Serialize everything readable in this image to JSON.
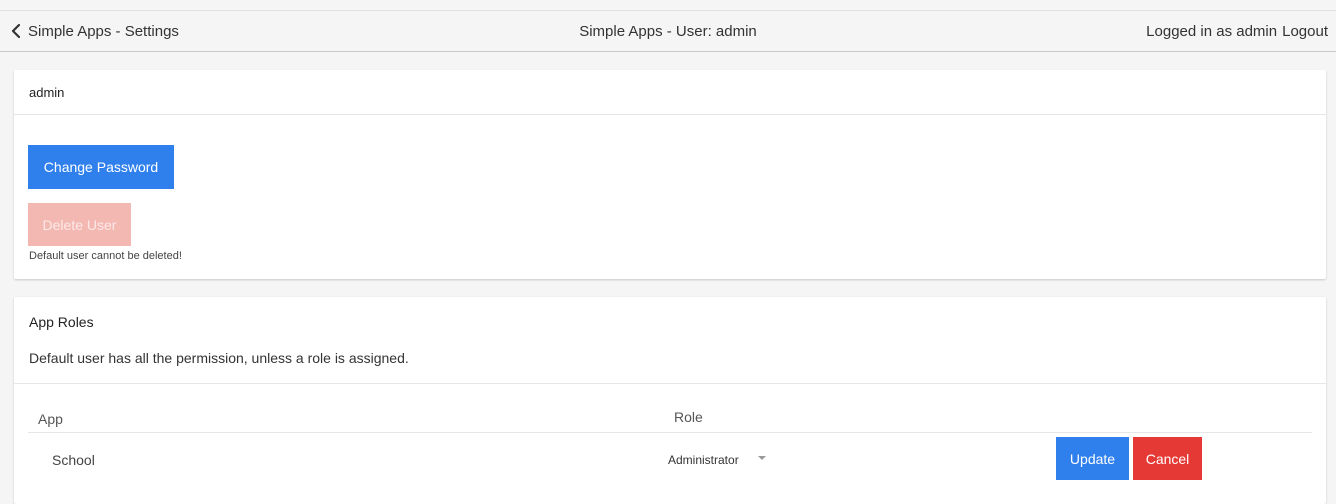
{
  "topbar": {
    "back_label": "Simple Apps - Settings",
    "title": "Simple Apps - User: admin",
    "logged_in_text": "Logged in as admin",
    "logout_label": "Logout"
  },
  "user_card": {
    "username": "admin",
    "change_password_label": "Change Password",
    "delete_user_label": "Delete User",
    "delete_note": "Default user cannot be deleted!"
  },
  "roles_card": {
    "title": "App Roles",
    "description": "Default user has all the permission, unless a role is assigned.",
    "columns": {
      "app": "App",
      "role": "Role"
    },
    "rows": [
      {
        "app": "School",
        "role": "Administrator"
      }
    ],
    "update_label": "Update",
    "cancel_label": "Cancel"
  },
  "colors": {
    "primary": "#2f80ed",
    "danger": "#e53935",
    "danger_disabled": "#f4b8b3"
  },
  "icons": [
    "chevron-left-icon",
    "caret-down-icon"
  ]
}
